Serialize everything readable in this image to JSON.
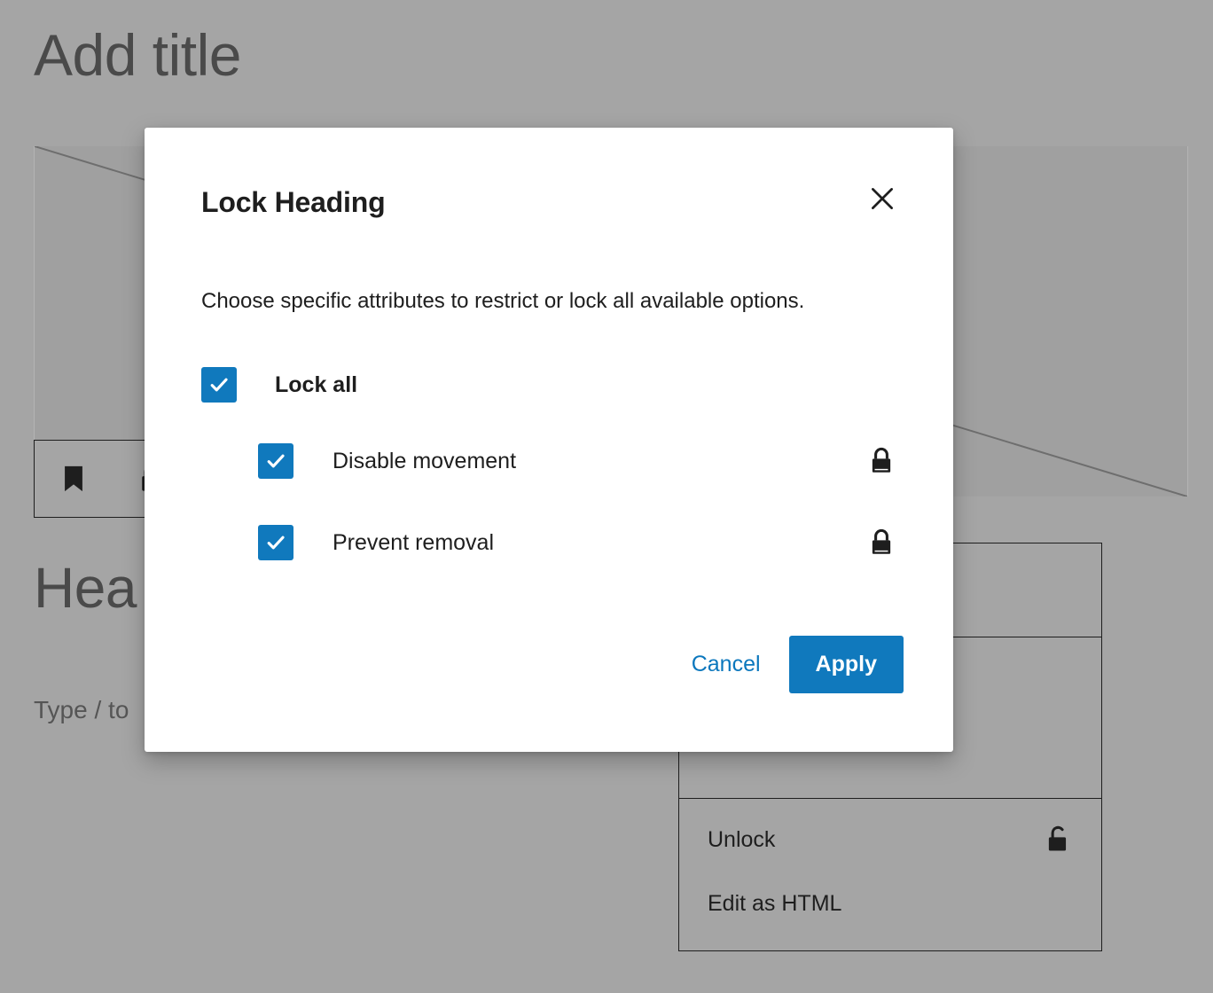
{
  "editor": {
    "post_title_placeholder": "Add title",
    "image_block": {
      "icon": "image-placeholder-icon"
    },
    "block_toolbar": {
      "bookmark_icon": "bookmark-icon",
      "lock_icon": "lock-closed-icon"
    },
    "heading_block_text": "Hea",
    "paragraph_placeholder": "Type / to",
    "block_options_menu": {
      "items": [
        {
          "label": "",
          "icon": ""
        },
        {
          "label": "",
          "icon": ""
        },
        {
          "label": "Unlock",
          "icon": "lock-open-icon"
        },
        {
          "label": "Edit as HTML",
          "icon": ""
        }
      ]
    }
  },
  "modal": {
    "title": "Lock Heading",
    "close_label": "Close",
    "close_icon": "close-icon",
    "description": "Choose specific attributes to restrict or lock all available options.",
    "options": [
      {
        "label": "Lock all",
        "checked": true,
        "level": "root",
        "icon": ""
      },
      {
        "label": "Disable movement",
        "checked": true,
        "level": "child",
        "icon": "lock-closed-icon"
      },
      {
        "label": "Prevent removal",
        "checked": true,
        "level": "child",
        "icon": "lock-closed-icon"
      }
    ],
    "cancel_label": "Cancel",
    "apply_label": "Apply"
  },
  "colors": {
    "accent_blue": "#1079bd",
    "link_blue": "#0b77bd",
    "text_dark": "#1e1e1e",
    "backdrop_gray": "#a5a5a5",
    "modal_white": "#ffffff"
  }
}
